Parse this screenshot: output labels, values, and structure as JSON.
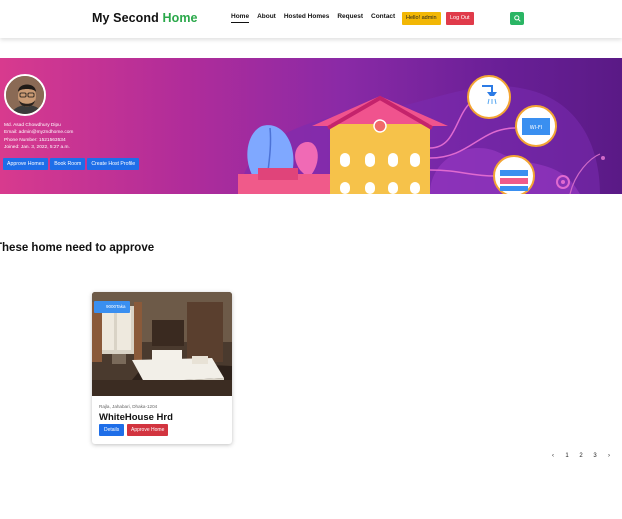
{
  "brand": {
    "part1": "My Second ",
    "part2": "Home"
  },
  "nav": {
    "items": [
      {
        "label": "Home"
      },
      {
        "label": "About"
      },
      {
        "label": "Hosted Homes"
      },
      {
        "label": "Request"
      },
      {
        "label": "Contact"
      }
    ],
    "hello": "Hello! admin",
    "logout": "Log Out",
    "search_icon": "search-icon"
  },
  "profile": {
    "name": "Md. Asad Chowdhury Dipu",
    "email": "Email: admin@my2ndhome.com",
    "phone": "Phone Number: 1521563534",
    "joined": "Joined: Jan. 3, 2022, 5:27 a.m.",
    "buttons": [
      "Approve Homes",
      "Book Room",
      "Create Host Profile"
    ]
  },
  "section": {
    "title": "These home need to approve"
  },
  "home_card": {
    "price": "9000Taka",
    "location": "Rajla, Jahabari, Dhaka-1204",
    "title": "WhiteHouse Hrd",
    "details_label": "Details",
    "approve_label": "Approve Home"
  },
  "pagination": {
    "prev": "‹",
    "pages": [
      "1",
      "2",
      "3"
    ],
    "next": "›"
  },
  "colors": {
    "brand_accent": "#2aa84a",
    "hello_button": "#f2b705",
    "logout_button": "#e03b4a",
    "search_button": "#2ab564",
    "primary_button": "#1e6ee8",
    "approve_button": "#d2343f"
  }
}
